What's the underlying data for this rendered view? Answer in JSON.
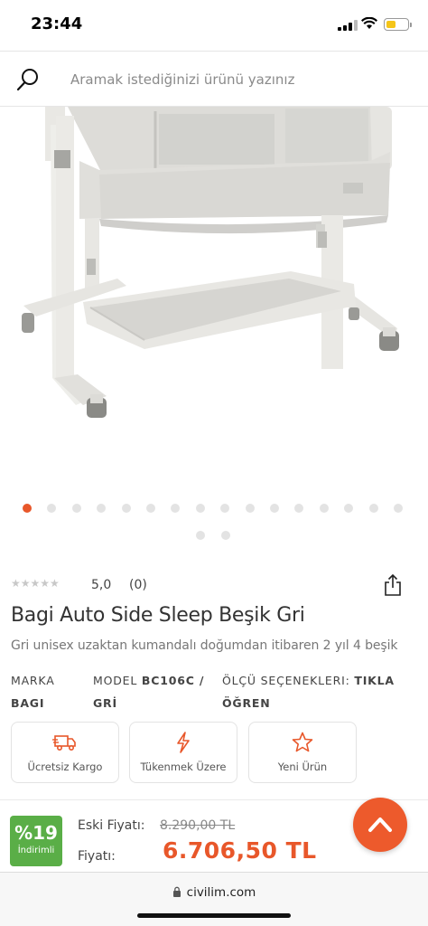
{
  "status": {
    "time": "23:44"
  },
  "search": {
    "placeholder": "Aramak istediğinizi ürünü yazınız"
  },
  "gallery": {
    "dot_count": 17,
    "active_index": 0
  },
  "product": {
    "rating_value": "5,0",
    "rating_count": "(0)",
    "rating_stars": 0,
    "title": "Bagi Auto Side Sleep Beşik Gri",
    "subtitle": "Gri unisex uzaktan kumandalı doğumdan itibaren 2 yıl 4 beşik",
    "brand_label": "MARKA",
    "brand_value": "BAGI",
    "model_label": "MODEL",
    "model_value_1": "BC106C /",
    "model_value_2": "GRİ",
    "size_label": "ÖLÇÜ SEÇENEKLERI:",
    "size_value_1": "TIKLA",
    "size_value_2": "ÖĞREN"
  },
  "badges": [
    {
      "label": "Ücretsiz Kargo",
      "icon": "truck-icon"
    },
    {
      "label": "Tükenmek Üzere",
      "icon": "lightning-icon"
    },
    {
      "label": "Yeni Ürün",
      "icon": "star-icon"
    }
  ],
  "pricing": {
    "discount_pct": "%19",
    "discount_label": "İndirimli",
    "old_label": "Eski Fiyatı:",
    "old_price": "8.290,00 TL",
    "price_label": "Fiyatı:",
    "price": "6.706,50 TL"
  },
  "browser": {
    "url": "civilim.com"
  },
  "colors": {
    "accent": "#e8572a",
    "discount": "#5aae47"
  }
}
